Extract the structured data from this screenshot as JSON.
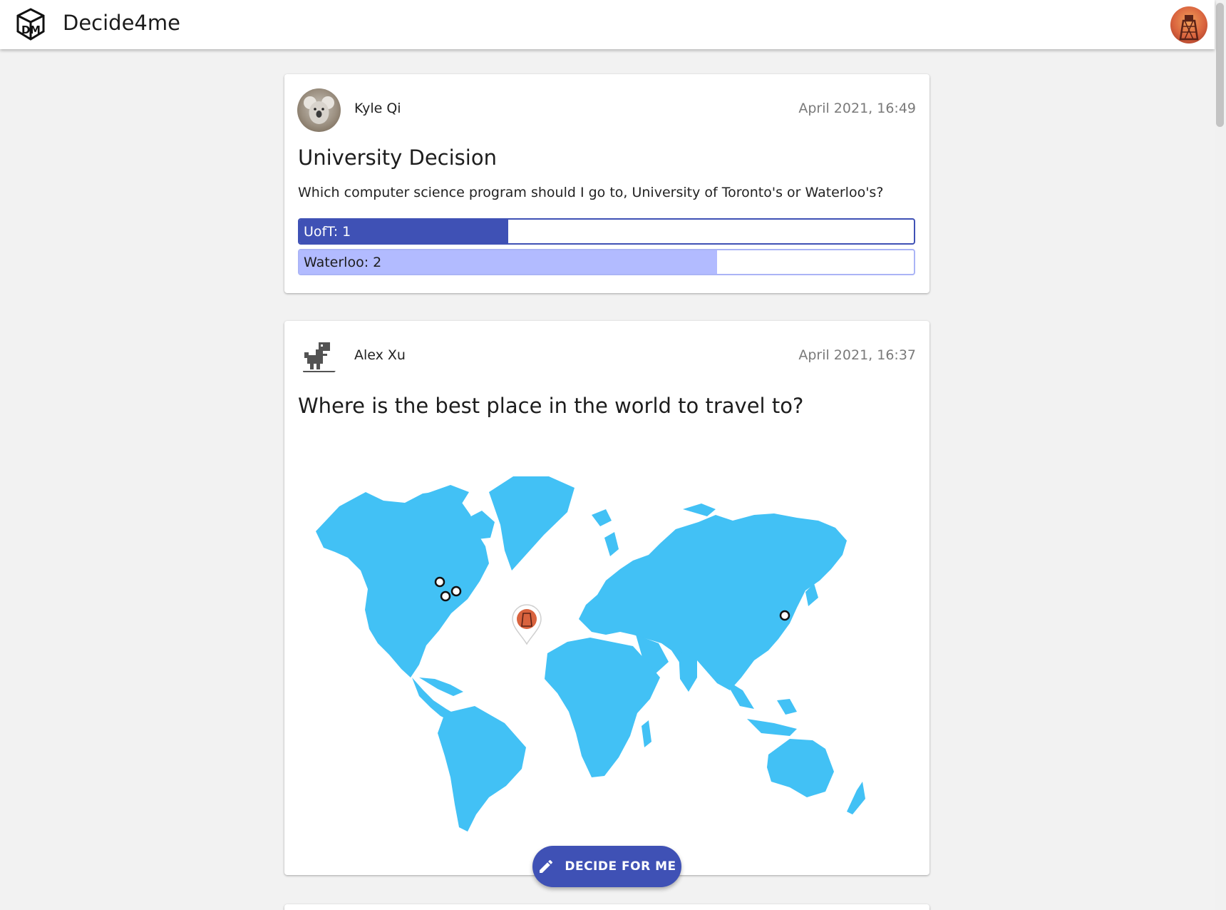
{
  "appbar": {
    "title": "Decide4me",
    "logo_icon": "dice-logo-icon",
    "avatar_icon": "user-avatar-icon"
  },
  "posts": [
    {
      "author": "Kyle Qi",
      "timestamp": "April 2021, 16:49",
      "title": "University Decision",
      "body": "Which computer science program should I go to, University of Toronto's or Waterloo's?",
      "options": [
        {
          "label": "UofT: 1",
          "votes": 1,
          "fill_fraction": 0.34
        },
        {
          "label": "Waterloo: 2",
          "votes": 2,
          "fill_fraction": 0.68
        }
      ],
      "colors": {
        "primary": "#3f51b5",
        "secondary": "#b2bbff"
      }
    },
    {
      "author": "Alex Xu",
      "timestamp": "April 2021, 16:37",
      "title": "Where is the best place in the world to travel to?",
      "map_color": "#42c1f5",
      "map_markers": 4,
      "current_user_pin": true
    }
  ],
  "fab": {
    "label": "DECIDE FOR ME",
    "icon": "pencil-icon"
  }
}
